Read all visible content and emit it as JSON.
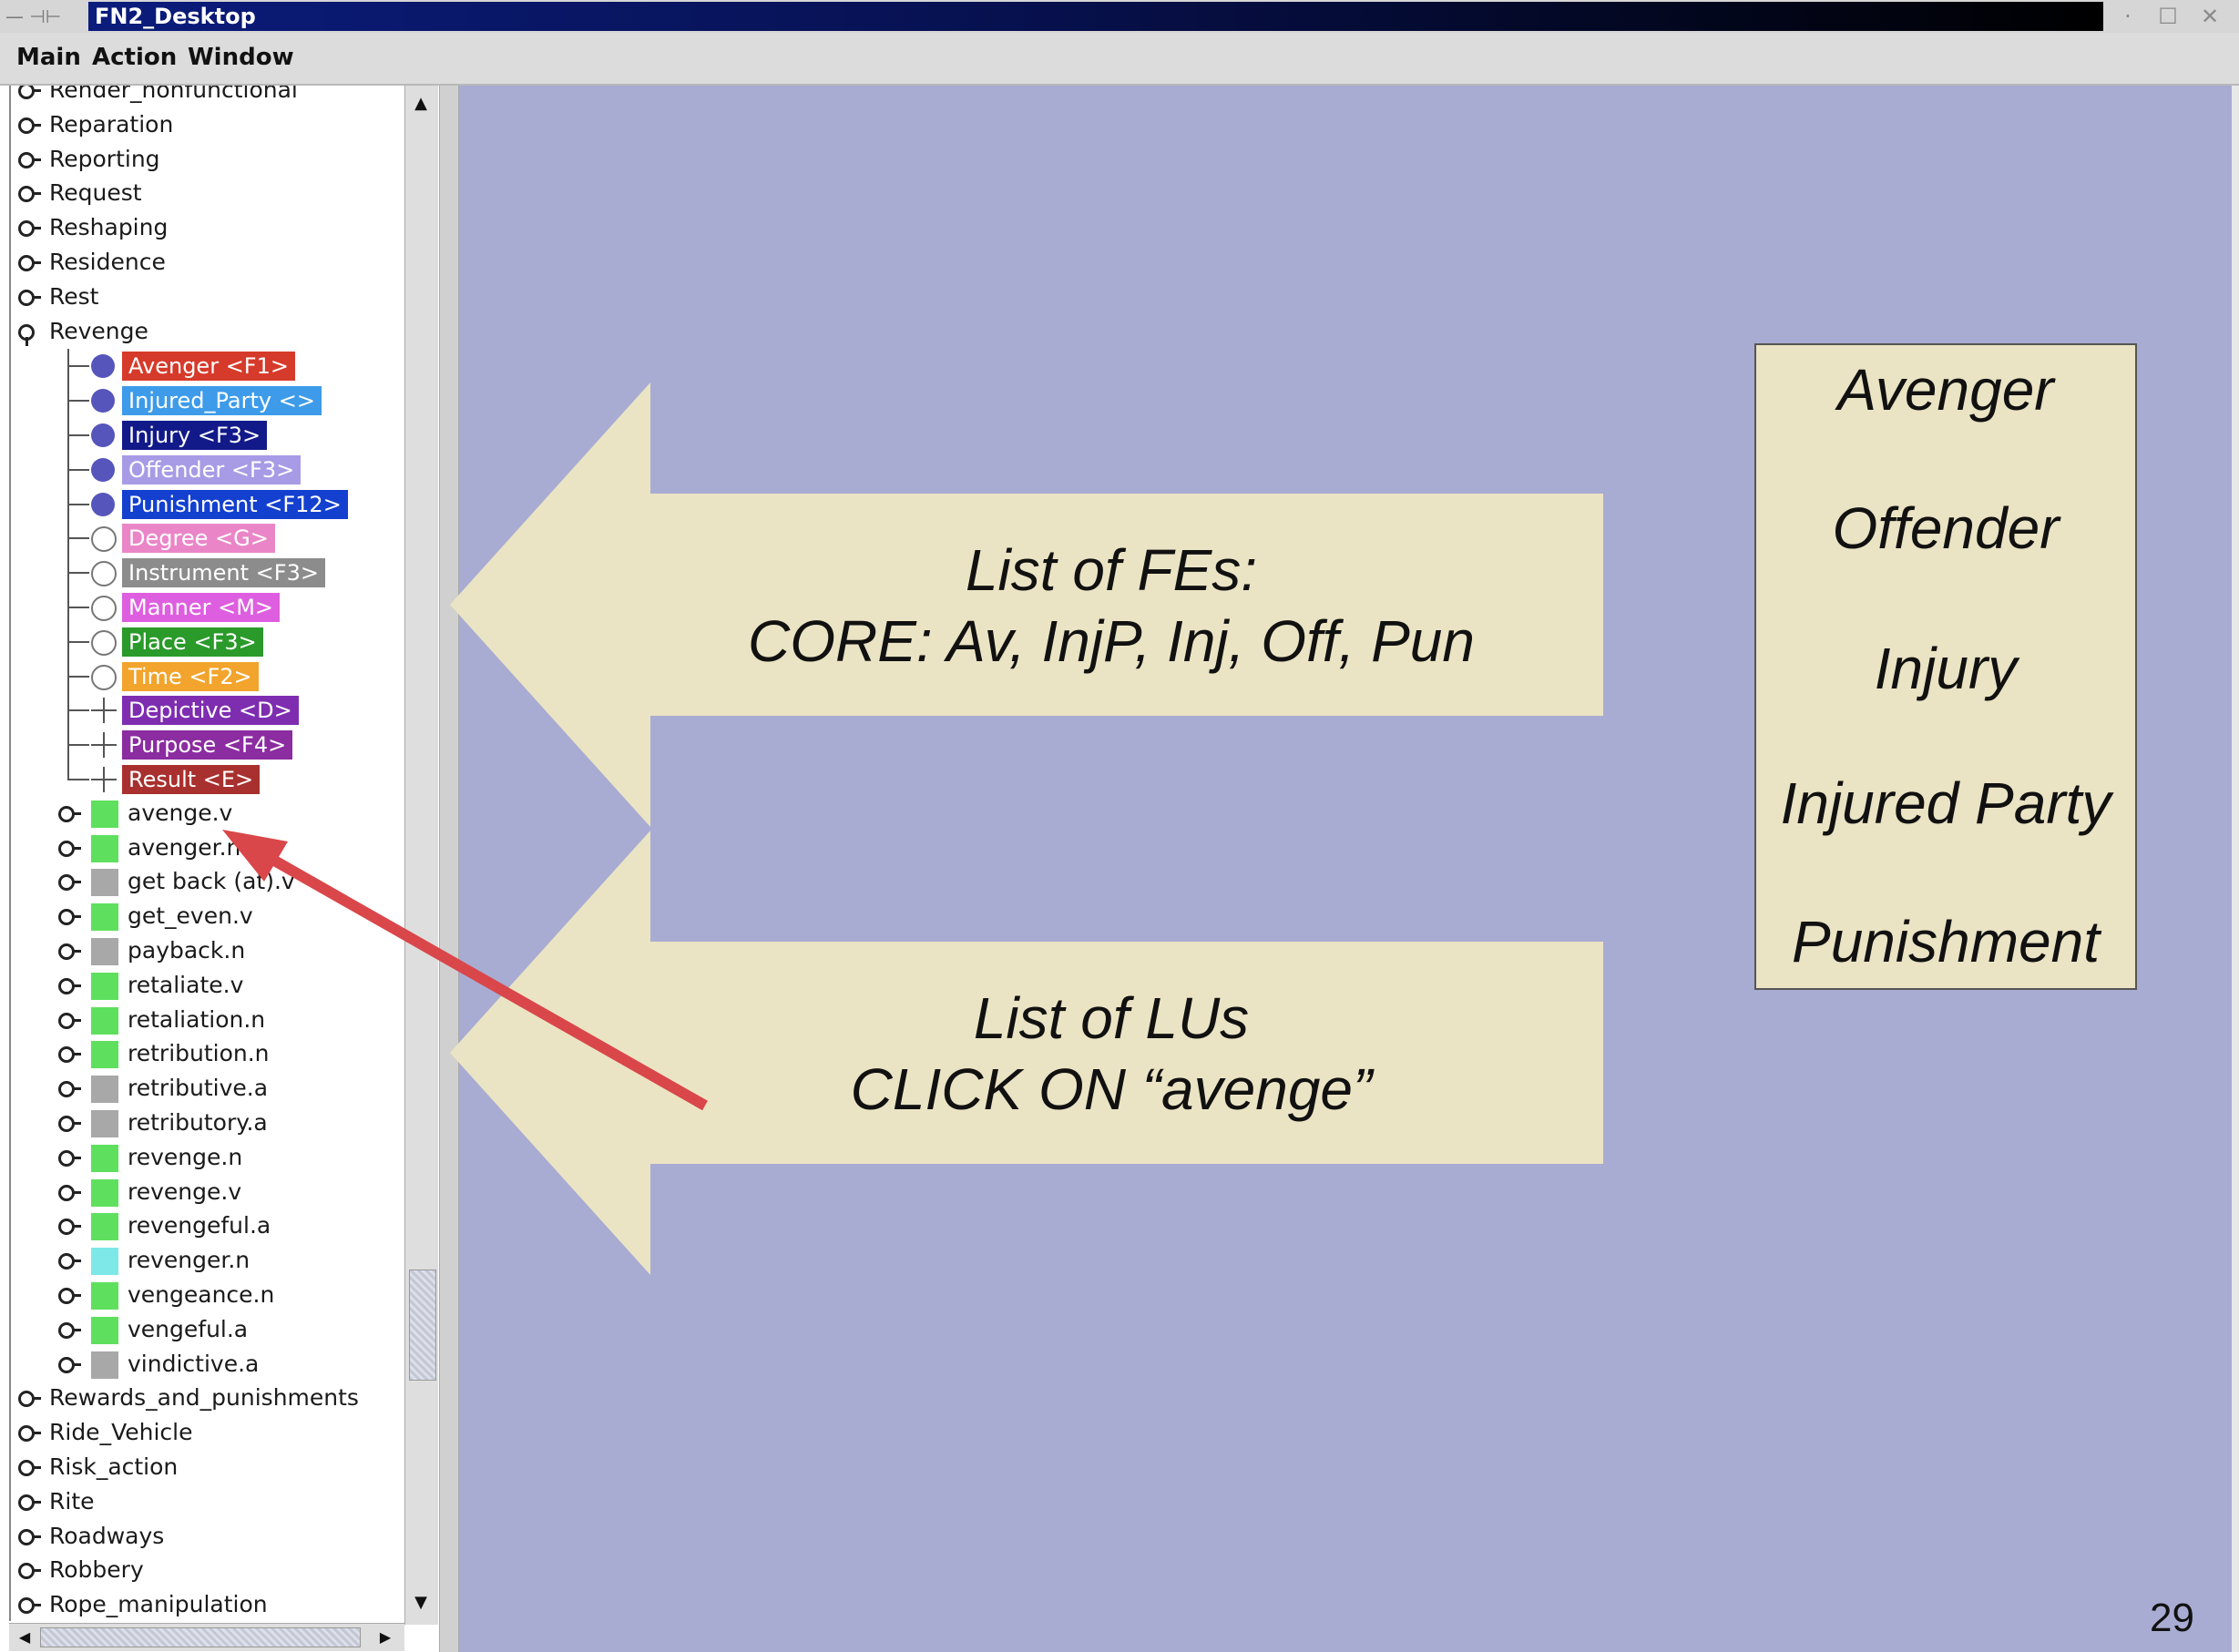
{
  "window": {
    "title": "FN2_Desktop",
    "controls": [
      "·",
      "☐",
      "✕"
    ]
  },
  "menu": [
    "Main",
    "Action",
    "Window"
  ],
  "frames_before": [
    {
      "label": "Render_nonfunctional"
    },
    {
      "label": "Reparation"
    },
    {
      "label": "Reporting"
    },
    {
      "label": "Request"
    },
    {
      "label": "Reshaping"
    },
    {
      "label": "Residence"
    },
    {
      "label": "Rest"
    }
  ],
  "expanded_frame": {
    "label": "Revenge",
    "frame_elements": [
      {
        "label": "Avenger <F1>",
        "kind": "core",
        "color": "#d63a2a"
      },
      {
        "label": "Injured_Party <>",
        "kind": "core",
        "color": "#3d9be9"
      },
      {
        "label": "Injury <F3>",
        "kind": "core",
        "color": "#121a8a"
      },
      {
        "label": "Offender <F3>",
        "kind": "core",
        "color": "#a79be6"
      },
      {
        "label": "Punishment <F12>",
        "kind": "core",
        "color": "#1440d0"
      },
      {
        "label": "Degree <G>",
        "kind": "peripheral",
        "color": "#ea86c8"
      },
      {
        "label": "Instrument <F3>",
        "kind": "peripheral",
        "color": "#8c8c8c"
      },
      {
        "label": "Manner <M>",
        "kind": "peripheral",
        "color": "#de5ee0"
      },
      {
        "label": "Place <F3>",
        "kind": "peripheral",
        "color": "#2a9a2a"
      },
      {
        "label": "Time <F2>",
        "kind": "peripheral",
        "color": "#f2a42c"
      },
      {
        "label": "Depictive <D>",
        "kind": "extra",
        "color": "#7e2db0"
      },
      {
        "label": "Purpose <F4>",
        "kind": "extra",
        "color": "#8b2ca0"
      },
      {
        "label": "Result <E>",
        "kind": "extra",
        "color": "#a8302e"
      }
    ],
    "lexical_units": [
      {
        "label": "avenge.v",
        "color": "#5ee05e"
      },
      {
        "label": "avenger.n",
        "color": "#5ee05e"
      },
      {
        "label": "get back (at).v",
        "color": "#a8a8a8"
      },
      {
        "label": "get_even.v",
        "color": "#5ee05e"
      },
      {
        "label": "payback.n",
        "color": "#a8a8a8"
      },
      {
        "label": "retaliate.v",
        "color": "#5ee05e"
      },
      {
        "label": "retaliation.n",
        "color": "#5ee05e"
      },
      {
        "label": "retribution.n",
        "color": "#5ee05e"
      },
      {
        "label": "retributive.a",
        "color": "#a8a8a8"
      },
      {
        "label": "retributory.a",
        "color": "#a8a8a8"
      },
      {
        "label": "revenge.n",
        "color": "#5ee05e"
      },
      {
        "label": "revenge.v",
        "color": "#5ee05e"
      },
      {
        "label": "revengeful.a",
        "color": "#5ee05e"
      },
      {
        "label": "revenger.n",
        "color": "#7ee8e8"
      },
      {
        "label": "vengeance.n",
        "color": "#5ee05e"
      },
      {
        "label": "vengeful.a",
        "color": "#5ee05e"
      },
      {
        "label": "vindictive.a",
        "color": "#a8a8a8"
      }
    ]
  },
  "frames_after": [
    {
      "label": "Rewards_and_punishments"
    },
    {
      "label": "Ride_Vehicle"
    },
    {
      "label": "Risk_action"
    },
    {
      "label": "Rite"
    },
    {
      "label": "Roadways"
    },
    {
      "label": "Robbery"
    },
    {
      "label": "Rope_manipulation"
    }
  ],
  "annotations": {
    "fe_arrow_line1": "List of FEs:",
    "fe_arrow_line2": "CORE: Av, InjP, Inj, Off, Pun",
    "lu_arrow_line1": "List of LUs",
    "lu_arrow_line2": "CLICK ON “avenge”",
    "core_fes": [
      "Avenger",
      "Offender",
      "Injury",
      "Injured Party",
      "Punishment"
    ],
    "arrow_fill": "#ebe4c4",
    "pointer_color": "#d9474a"
  },
  "slide_number": "29",
  "colors": {
    "main_background": "#a8acd2",
    "titlebar": "#0b1c7c"
  }
}
